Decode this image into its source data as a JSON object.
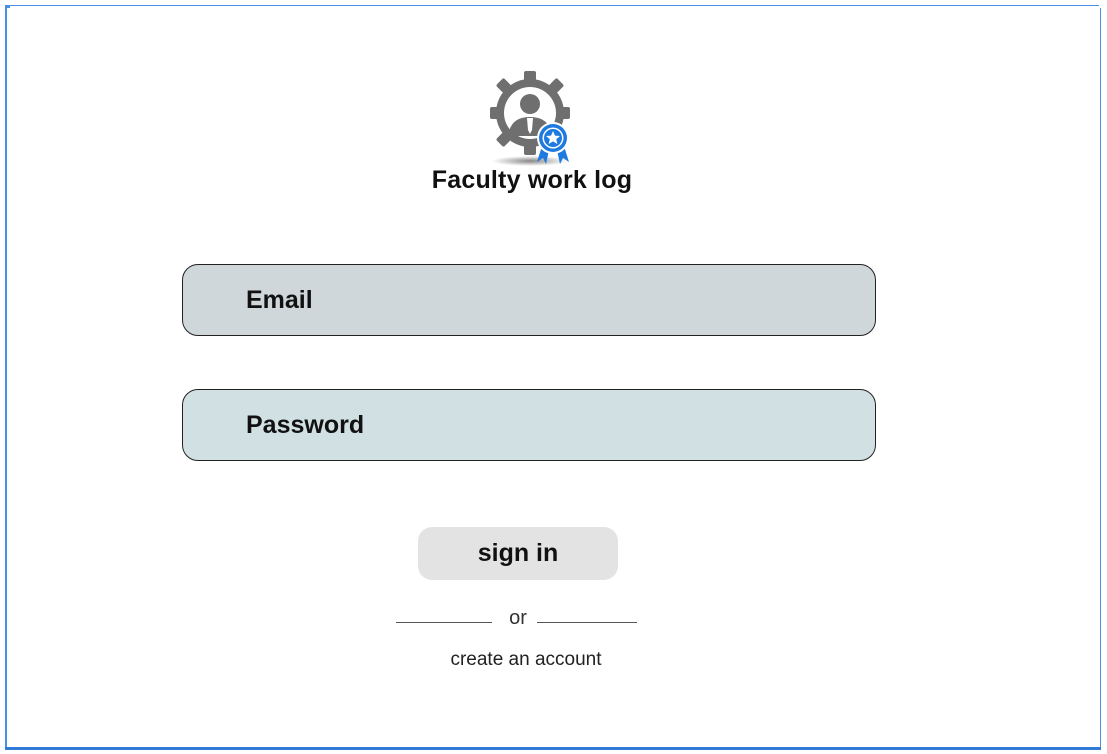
{
  "app": {
    "title": "Faculty work log",
    "logo_icon": "faculty-badge-icon"
  },
  "form": {
    "email_placeholder": "Email",
    "password_placeholder": "Password",
    "email_value": "",
    "password_value": ""
  },
  "actions": {
    "sign_in_label": "sign in",
    "divider_text": "or",
    "create_account_label": "create an account"
  },
  "colors": {
    "email_bg": "#cfd7da",
    "password_bg": "#d1e0e3",
    "button_bg": "#e3e3e3",
    "logo_gray": "#6f6f6f",
    "logo_blue": "#1f7ae0",
    "frame_blue": "#4a90e2"
  }
}
